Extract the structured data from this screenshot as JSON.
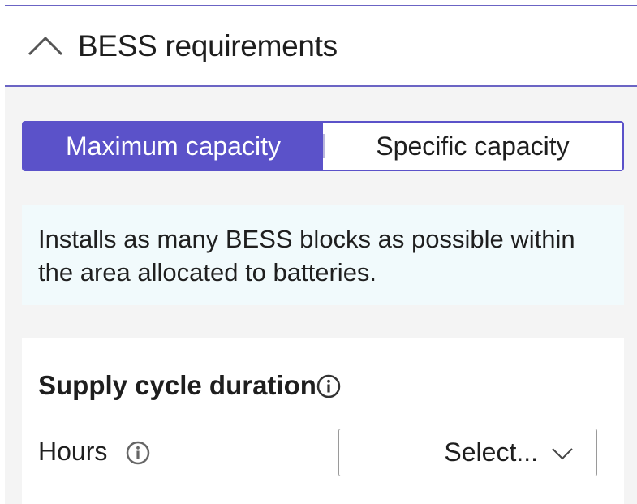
{
  "section": {
    "title": "BESS requirements",
    "expanded": true,
    "icon": "chevron-up-icon"
  },
  "mode_toggle": {
    "options": [
      "Maximum capacity",
      "Specific capacity"
    ],
    "selected": "Maximum capacity"
  },
  "info_box": {
    "text": "Installs as many BESS blocks as possible within the area allocated to batteries."
  },
  "supply_cycle": {
    "title": "Supply cycle duration",
    "title_icon": "info-icon",
    "hours_label": "Hours",
    "hours_icon": "info-icon",
    "hours_select_value": "Select...",
    "hours_select_icon": "chevron-down-icon"
  },
  "colors": {
    "accent": "#5b52c9",
    "rule": "#6b64c4",
    "panel_bg": "#f4f4f4",
    "info_bg": "#f1fafc"
  }
}
